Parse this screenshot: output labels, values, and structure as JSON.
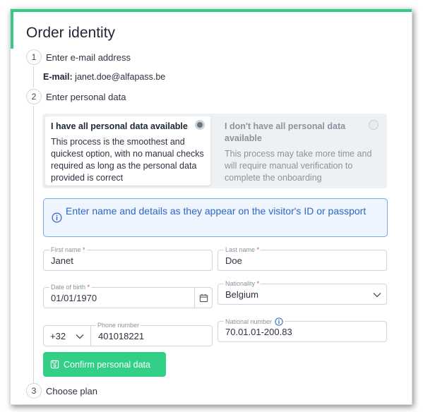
{
  "page": {
    "title": "Order identity"
  },
  "steps": [
    {
      "number": "1",
      "label": "Enter e-mail address"
    },
    {
      "number": "2",
      "label": "Enter personal data"
    },
    {
      "number": "3",
      "label": "Choose plan"
    }
  ],
  "email": {
    "label": "E-mail:",
    "value": "janet.doe@alfapass.be"
  },
  "options": {
    "available": {
      "title": "I have all personal data available",
      "description": "This process is the smoothest and quickest option, with no manual checks required as long as the personal data provided is correct",
      "selected": true
    },
    "unavailable": {
      "title": "I don't have all personal data available",
      "description": "This process may take more time and will require manual verification to complete the onboarding",
      "selected": false
    }
  },
  "info": {
    "text": "Enter name and details as they appear on the visitor's ID or passport"
  },
  "form": {
    "first_name": {
      "label": "First name",
      "required": "*",
      "value": "Janet"
    },
    "last_name": {
      "label": "Last name",
      "required": "*",
      "value": "Doe"
    },
    "date_of_birth": {
      "label": "Date of birth",
      "required": "*",
      "value": "01/01/1970"
    },
    "nationality": {
      "label": "Nationality",
      "required": "*",
      "value": "Belgium"
    },
    "phone_prefix": {
      "value": "+32"
    },
    "phone_number": {
      "label": "Phone number",
      "value": "401018221"
    },
    "national_number": {
      "label": "National number",
      "value": "70.01.01-200.83"
    }
  },
  "buttons": {
    "confirm": "Confirm personal data"
  },
  "colors": {
    "accent": "#32d087",
    "info_text": "#2f66c4",
    "info_border": "#7aa9e6",
    "required": "#e04a4a"
  }
}
